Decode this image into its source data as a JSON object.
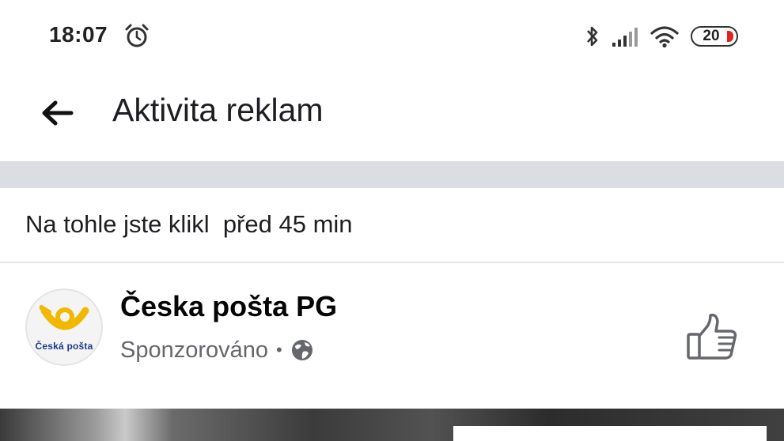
{
  "status_bar": {
    "time": "18:07",
    "battery_level": "20",
    "icons": [
      "alarm-icon",
      "bluetooth-icon",
      "signal-icon",
      "wifi-icon",
      "battery-icon"
    ],
    "battery_fill_color": "#e02424"
  },
  "app_bar": {
    "back_icon": "arrow-left-icon",
    "title": "Aktivita reklam"
  },
  "activity": {
    "text": "Na tohle jste klikl  před 45 min"
  },
  "ad": {
    "page_name": "Česka pošta PG",
    "sponsored_label": "Sponzorováno",
    "separator": "•",
    "audience_icon": "globe-icon",
    "like_icon": "thumbs-up-icon",
    "avatar_logo_text": "Česká pošta",
    "brand_color": "#f2b800"
  },
  "colors": {
    "divider_band": "#dadde1",
    "secondary_text": "#65676b",
    "primary_text": "#1c1e21"
  }
}
